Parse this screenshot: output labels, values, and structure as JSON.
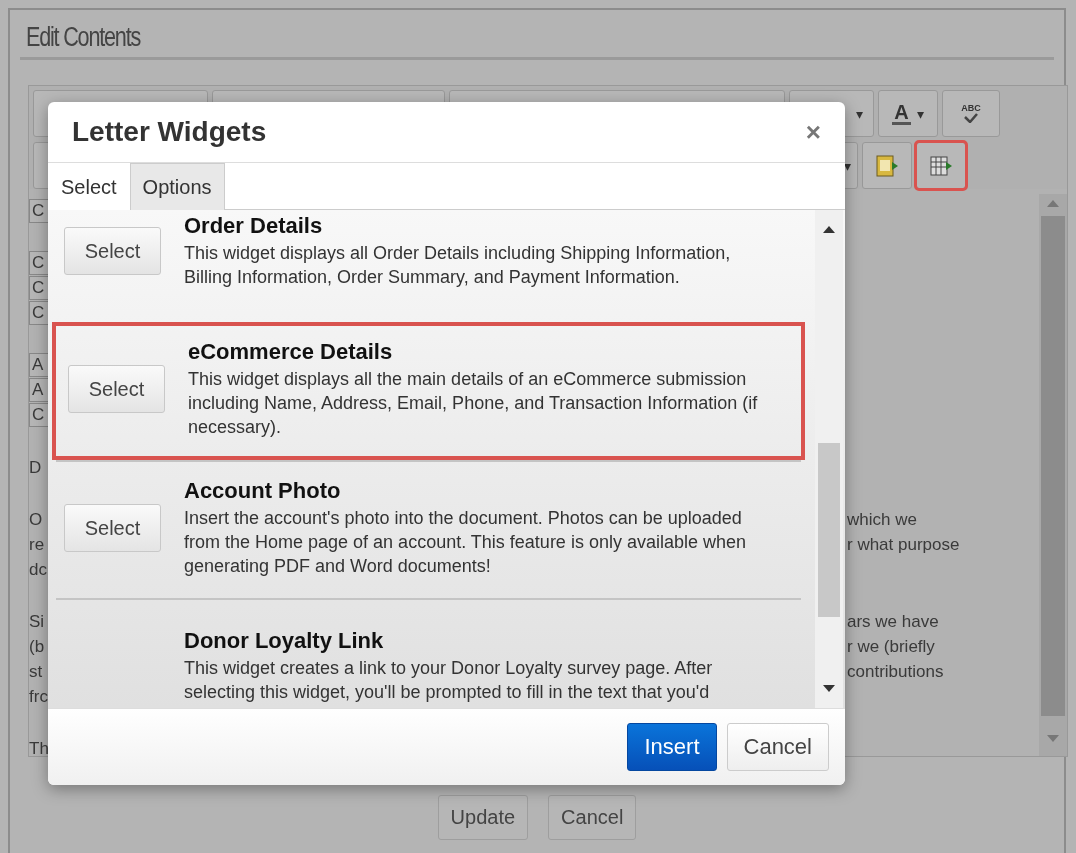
{
  "page": {
    "title": "Edit Contents"
  },
  "toolbar": {
    "rows": [
      [
        {
          "kind": "dropdown"
        },
        {
          "kind": "dropdown"
        },
        {
          "kind": "dropdown"
        },
        {
          "kind": "caret",
          "label": "▾"
        },
        {
          "kind": "font-color",
          "label": "A",
          "caret": "▾"
        },
        {
          "kind": "spellcheck",
          "label": "ABC"
        }
      ],
      [
        {
          "kind": "dropdown",
          "caret": "▾"
        },
        {
          "kind": "insert-document",
          "highlighted": false
        },
        {
          "kind": "insert-table",
          "highlighted": true
        }
      ]
    ]
  },
  "editor": {
    "paragraphs": [
      {
        "kind": "table",
        "lines": [
          {
            "left": "C"
          }
        ]
      },
      {
        "kind": "table",
        "lines": [
          {
            "left": "C"
          },
          {
            "left": "C"
          },
          {
            "left": "C"
          }
        ]
      },
      {
        "kind": "table",
        "lines": [
          {
            "left": "A"
          },
          {
            "left": "A"
          },
          {
            "left": "C"
          }
        ]
      },
      {
        "kind": "text",
        "lines": [
          {
            "left": "D"
          }
        ]
      },
      {
        "kind": "text",
        "lines": [
          {
            "left": "O",
            "right": "which we"
          },
          {
            "left": "re",
            "right": "r what purpose"
          },
          {
            "left": "dc"
          }
        ]
      },
      {
        "kind": "text",
        "lines": [
          {
            "left": "Si",
            "right": "ars we have"
          },
          {
            "left": "(b",
            "right": "r we (briefly"
          },
          {
            "left": "st",
            "right": "contributions"
          },
          {
            "left": "frc"
          }
        ]
      },
      {
        "kind": "text",
        "lines": [
          {
            "left": "Th"
          }
        ]
      }
    ]
  },
  "buttons": [
    {
      "label": "Update"
    },
    {
      "label": "Cancel"
    }
  ],
  "dialog": {
    "title": "Letter Widgets",
    "close": "×",
    "tabs": [
      {
        "label": "Select",
        "selected": true
      },
      {
        "label": "Options",
        "selected": false
      }
    ],
    "widgets": [
      {
        "title": "Order Details",
        "description": "This widget displays all Order Details including Shipping Information, Billing Information, Order Summary, and Payment Information.",
        "button": "Select",
        "highlighted": false
      },
      {
        "title": "eCommerce Details",
        "description": "This widget displays all the main details of an eCommerce submission including Name, Address, Email, Phone, and Transaction Information (if necessary).",
        "button": "Select",
        "highlighted": true
      },
      {
        "title": "Account Photo",
        "description": "Insert the account's photo into the document. Photos can be uploaded from the Home page of an account. This feature is only available when generating PDF and Word documents!",
        "button": "Select",
        "highlighted": false
      },
      {
        "title": "Donor Loyalty Link",
        "description": "This widget creates a link to your Donor Loyalty survey page. After selecting this widget, you'll be prompted to fill in the text that you'd",
        "highlighted": false
      }
    ],
    "buttons": [
      {
        "label": "Insert",
        "kind": "primary"
      },
      {
        "label": "Cancel",
        "kind": "default"
      }
    ]
  }
}
